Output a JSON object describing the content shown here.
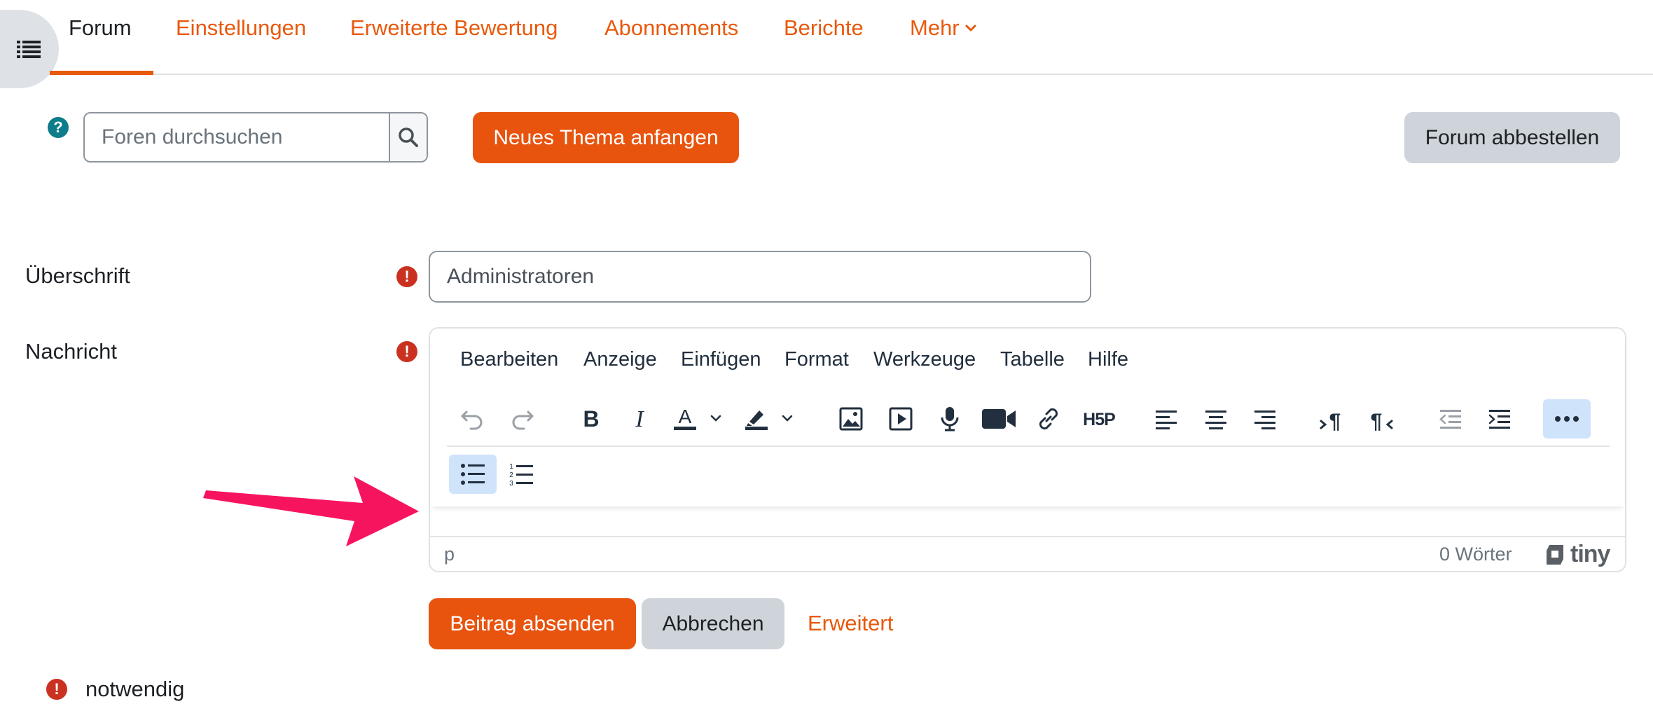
{
  "nav": {
    "tabs": [
      "Forum",
      "Einstellungen",
      "Erweiterte Bewertung",
      "Abonnements",
      "Berichte",
      "Mehr"
    ],
    "active_index": 0
  },
  "search": {
    "placeholder": "Foren durchsuchen",
    "value": ""
  },
  "buttons": {
    "new_topic": "Neues Thema anfangen",
    "unsubscribe": "Forum abbestellen",
    "submit": "Beitrag absenden",
    "cancel": "Abbrechen",
    "advanced": "Erweitert"
  },
  "form": {
    "subject_label": "Überschrift",
    "subject_value": "Administratoren",
    "message_label": "Nachricht",
    "required_note": "notwendig"
  },
  "editor": {
    "menu": [
      "Bearbeiten",
      "Anzeige",
      "Einfügen",
      "Format",
      "Werkzeuge",
      "Tabelle",
      "Hilfe"
    ],
    "status_path": "p",
    "word_count": "0 Wörter",
    "brand": "tiny"
  },
  "colors": {
    "accent": "#e8590c",
    "primary_button": "#e8530e",
    "secondary_button": "#ced4da",
    "required": "#ca3120",
    "help": "#0f7c8c",
    "annotation_arrow": "#f7145f",
    "toolbar_active": "#cfe3fb"
  }
}
